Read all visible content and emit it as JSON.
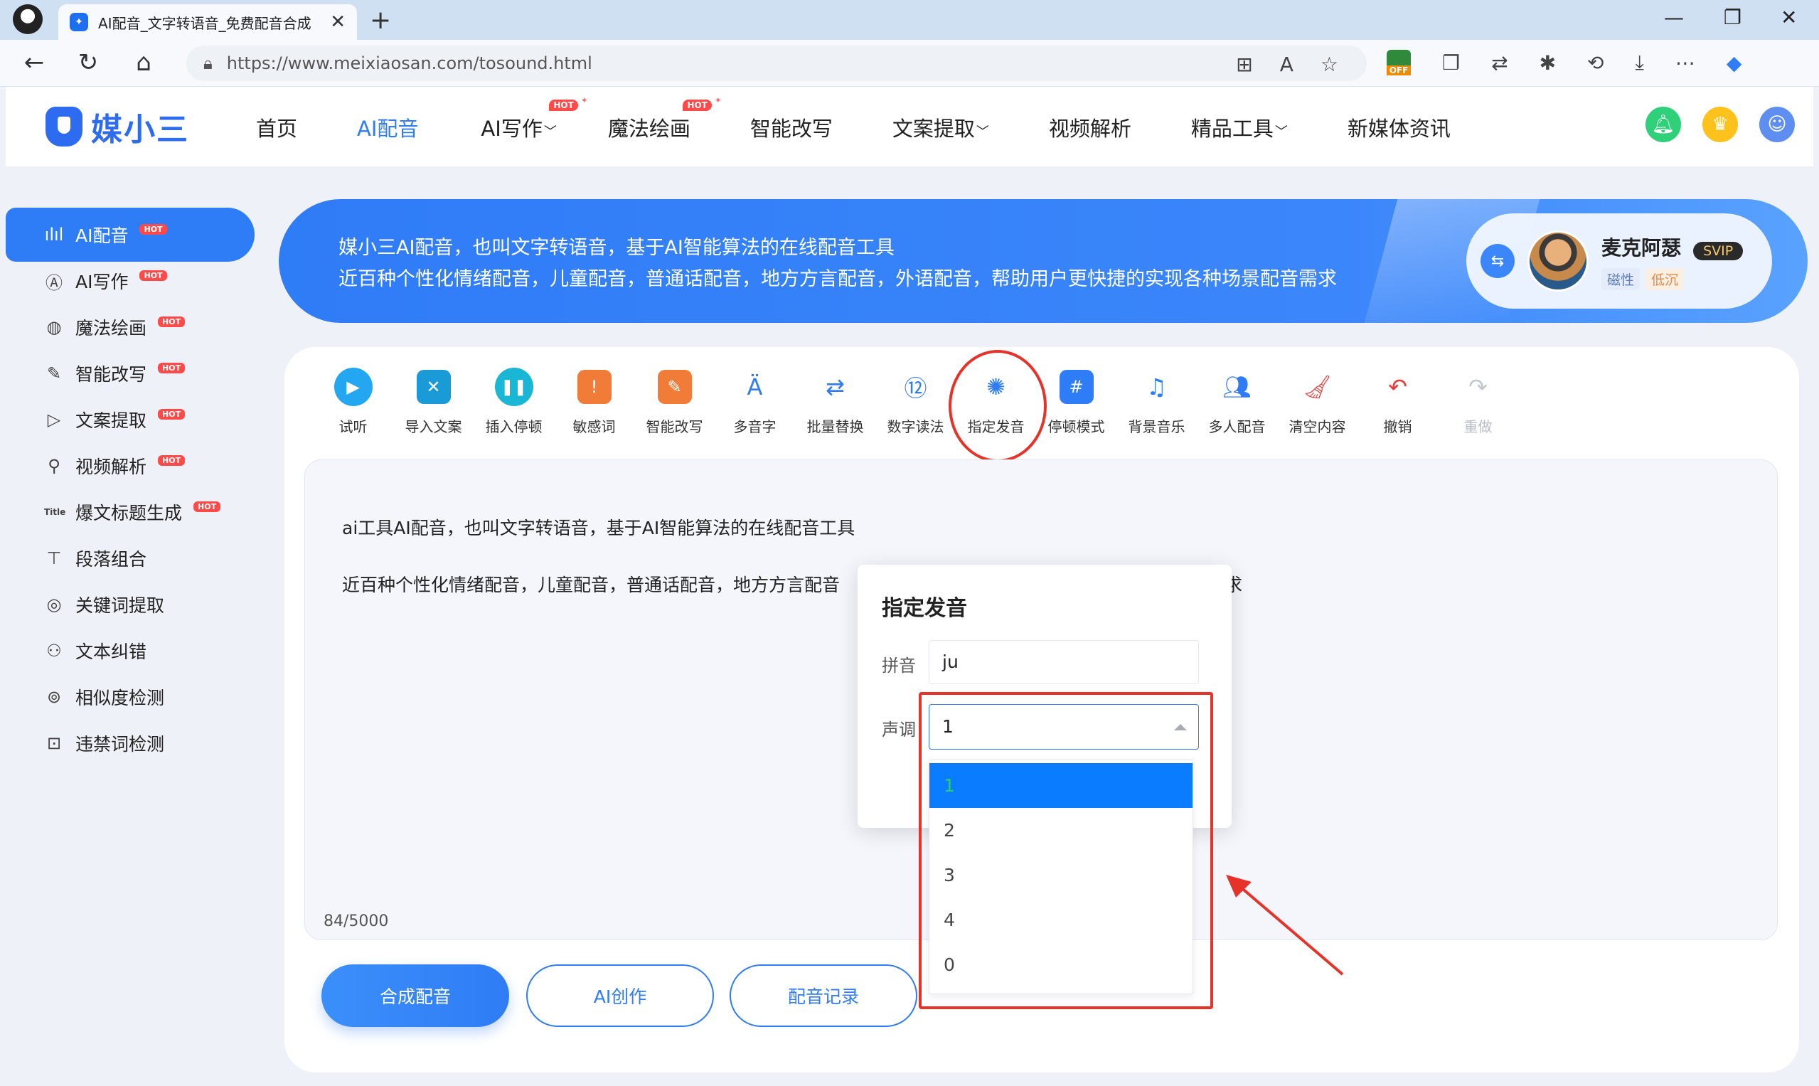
{
  "browser": {
    "tab_title": "AI配音_文字转语音_免费配音合成",
    "tab_close": "✕",
    "new_tab": "+",
    "url": "https://www.meixiaosan.com/tosound.html",
    "window_controls": [
      "—",
      "❐",
      "✕"
    ],
    "ext_off_label": "OFF"
  },
  "site": {
    "logo_text": "媒小三",
    "nav": [
      {
        "label": "首页"
      },
      {
        "label": "AI配音",
        "active": true
      },
      {
        "label": "AI写作",
        "hot": "HOT"
      },
      {
        "label": "魔法绘画",
        "hot": "HOT"
      },
      {
        "label": "智能改写"
      },
      {
        "label": "文案提取"
      },
      {
        "label": "视频解析"
      },
      {
        "label": "精品工具"
      },
      {
        "label": "新媒体资讯"
      }
    ]
  },
  "sidebar": {
    "items": [
      {
        "label": "AI配音",
        "hot": "HOT",
        "icon": "waveform-icon"
      },
      {
        "label": "AI写作",
        "hot": "HOT",
        "icon": "ai-write-icon"
      },
      {
        "label": "魔法绘画",
        "hot": "HOT",
        "icon": "palette-icon"
      },
      {
        "label": "智能改写",
        "hot": "HOT",
        "icon": "edit-icon"
      },
      {
        "label": "文案提取",
        "hot": "HOT",
        "icon": "video-text-icon"
      },
      {
        "label": "视频解析",
        "hot": "HOT",
        "icon": "video-parse-icon"
      },
      {
        "label": "爆文标题生成",
        "hot": "HOT",
        "icon": "title-icon",
        "icon_text": "Title"
      },
      {
        "label": "段落组合",
        "icon": "paragraph-icon"
      },
      {
        "label": "关键词提取",
        "icon": "keyword-icon"
      },
      {
        "label": "文本纠错",
        "icon": "correct-icon"
      },
      {
        "label": "相似度检测",
        "icon": "similarity-icon"
      },
      {
        "label": "违禁词检测",
        "icon": "forbidden-icon"
      }
    ]
  },
  "banner": {
    "line1": "媒小三AI配音，也叫文字转语音，基于AI智能算法的在线配音工具",
    "line2": "近百种个性化情绪配音，儿童配音，普通话配音，地方方言配音，外语配音，帮助用户更快捷的实现各种场景配音需求",
    "voice": {
      "name": "麦克阿瑟",
      "badge": "SVIP",
      "tags": [
        "磁性",
        "低沉"
      ]
    }
  },
  "toolbar": {
    "tools": [
      {
        "label": "试听",
        "icon": "play-icon"
      },
      {
        "label": "导入文案",
        "icon": "import-icon"
      },
      {
        "label": "插入停顿",
        "icon": "pause-icon"
      },
      {
        "label": "敏感词",
        "icon": "sensitive-icon"
      },
      {
        "label": "智能改写",
        "icon": "rewrite-icon"
      },
      {
        "label": "多音字",
        "icon": "polyphone-icon"
      },
      {
        "label": "批量替换",
        "icon": "replace-icon"
      },
      {
        "label": "数字读法",
        "icon": "number-icon"
      },
      {
        "label": "指定发音",
        "icon": "pronounce-icon"
      },
      {
        "label": "停顿模式",
        "icon": "hash-icon"
      },
      {
        "label": "背景音乐",
        "icon": "music-icon"
      },
      {
        "label": "多人配音",
        "icon": "users-icon"
      },
      {
        "label": "清空内容",
        "icon": "broom-icon"
      },
      {
        "label": "撤销",
        "icon": "undo-icon"
      },
      {
        "label": "重做",
        "icon": "redo-icon",
        "disabled": true
      }
    ]
  },
  "editor": {
    "paragraph1": "ai工具AI配音，也叫文字转语音，基于AI智能算法的在线配音工具",
    "paragraph2_start": "近百种个性化情绪配音，儿童配音，普通话配音，地方方言配音",
    "paragraph2_end": "配音需求",
    "char_count": "84/5000"
  },
  "actions": {
    "synthesize": "合成配音",
    "ai_create": "AI创作",
    "records": "配音记录"
  },
  "dialog": {
    "title": "指定发音",
    "pinyin_label": "拼音",
    "pinyin_value": "ju",
    "tone_label": "声调",
    "tone_value": "1",
    "tone_options": [
      "1",
      "2",
      "3",
      "4",
      "0"
    ],
    "selected_index": 0
  },
  "colors": {
    "primary": "#2e7cf6",
    "hot": "#ff4a4a",
    "annotation_red": "#e6332a"
  }
}
